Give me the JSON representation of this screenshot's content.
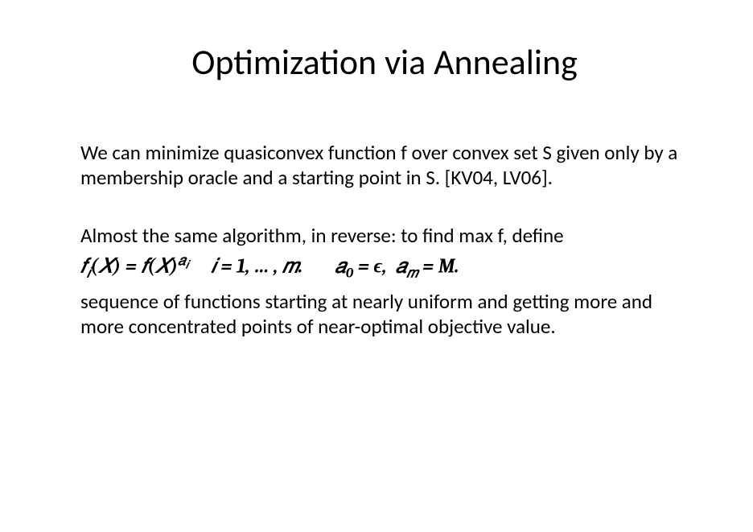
{
  "title": "Optimization via Annealing",
  "para1": "We can minimize quasiconvex function f over convex set S given only by a membership oracle and a starting point in S. [KV04, LV06].",
  "para2": "Almost the same algorithm, in reverse: to find max f, define",
  "math": {
    "fi": "𝑓",
    "i_sub": "𝑖",
    "X": "𝑋",
    "eq": "=",
    "f": "𝑓",
    "a": "𝑎",
    "range": "𝑖 = 1, … , 𝑚.",
    "a0": "𝑎",
    "zero": "0",
    "eps": "= ϵ,",
    "am": "𝑎",
    "m_sub": "𝑚",
    "M": "= M."
  },
  "para3": "sequence of functions starting at nearly uniform and getting more and more concentrated points of near-optimal objective value."
}
